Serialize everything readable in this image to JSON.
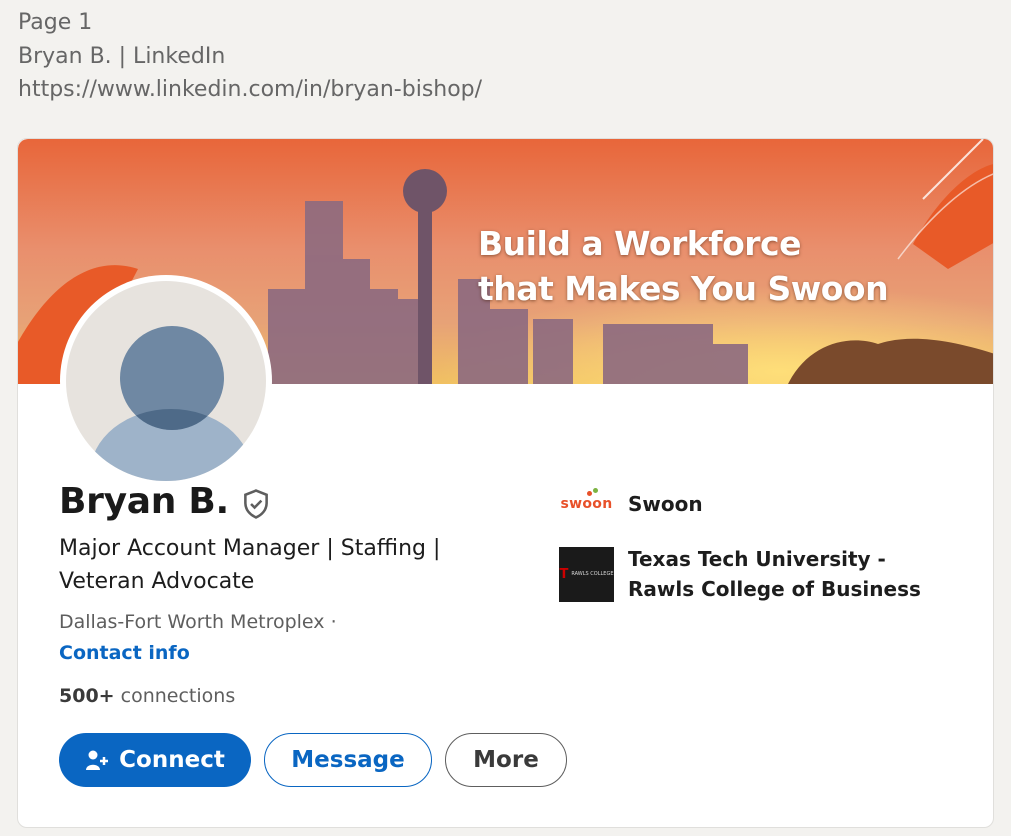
{
  "print_header": {
    "page": "Page 1",
    "title": "Bryan B. | LinkedIn",
    "url": "https://www.linkedin.com/in/bryan-bishop/"
  },
  "banner": {
    "line1": "Build a Workforce",
    "line2": "that Makes You Swoon"
  },
  "profile": {
    "name": "Bryan B.",
    "headline": "Major Account Manager | Staffing | Veteran Advocate",
    "location": "Dallas-Fort Worth Metroplex ·",
    "contact_info": "Contact info",
    "connections_count": "500+",
    "connections_label": " connections"
  },
  "experience": [
    {
      "name": "Swoon",
      "logo_text": "swoon"
    },
    {
      "name": "Texas Tech University - Rawls College of Business",
      "logo_text": "RAWLS COLLEGE"
    }
  ],
  "actions": {
    "connect": "Connect",
    "message": "Message",
    "more": "More"
  },
  "colors": {
    "brand_blue": "#0a66c2",
    "swoon_orange": "#e8512a"
  }
}
